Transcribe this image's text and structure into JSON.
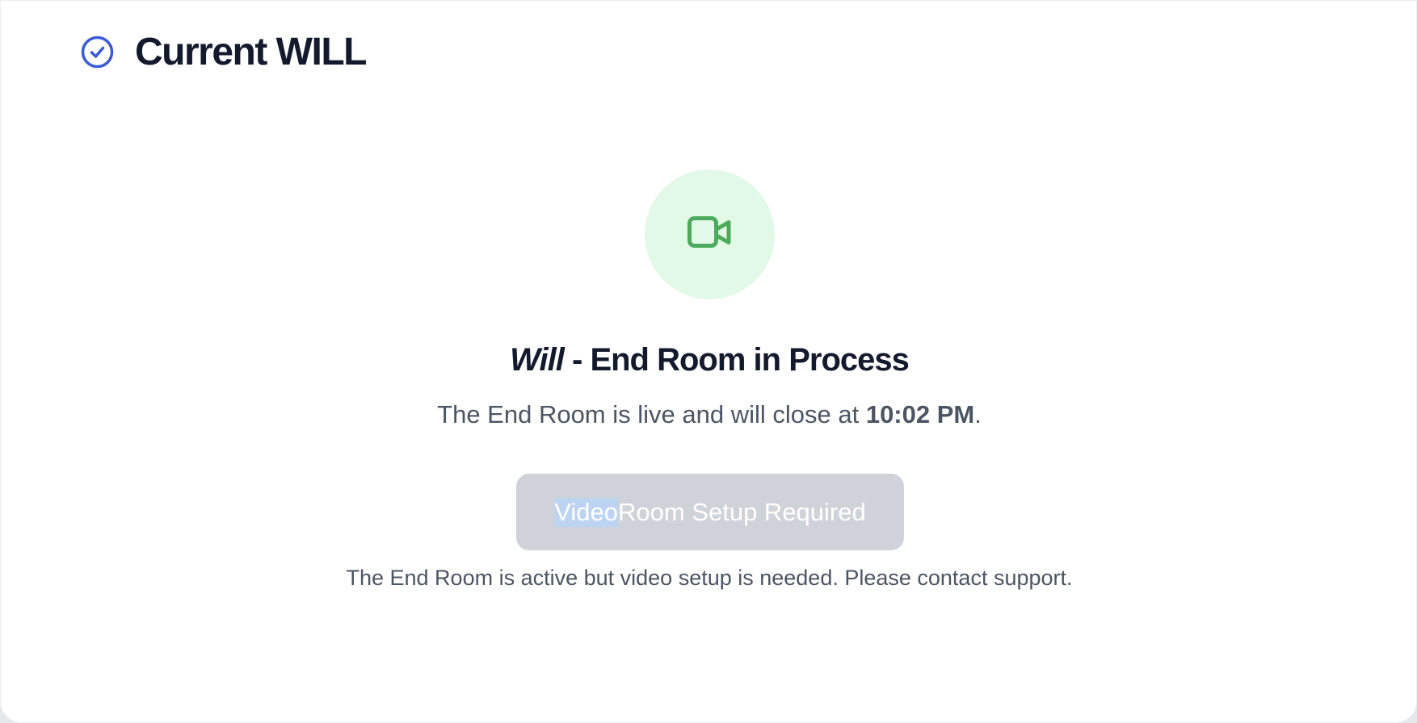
{
  "header": {
    "title": "Current WILL",
    "icon": "check-circle-icon",
    "icon_color": "#3b5bd6"
  },
  "status": {
    "icon": "video-camera-icon",
    "icon_color": "#4caa5c",
    "icon_bg": "#e3f9e8",
    "title_italic": "Will",
    "title_rest": " - End Room in Process",
    "desc_prefix": "The End Room is live and will close at ",
    "close_time": "10:02 PM",
    "desc_suffix": "."
  },
  "action": {
    "button_selected_part": "Video",
    "button_rest": " Room Setup Required",
    "disabled": true
  },
  "help_text": "The End Room is active but video setup is needed. Please contact support."
}
